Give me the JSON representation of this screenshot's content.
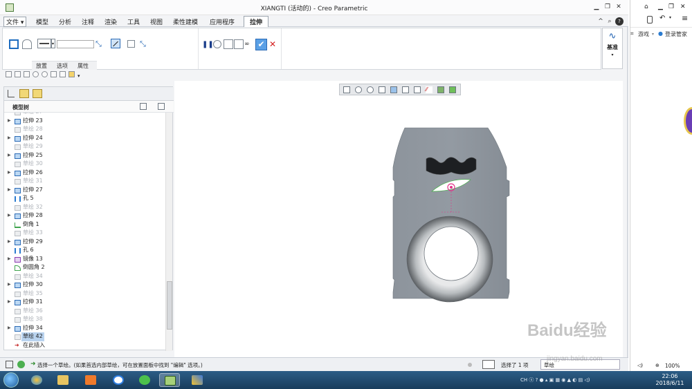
{
  "window": {
    "title": "XIANGTI (活动的) - Creo Parametric"
  },
  "menu": {
    "file": "文件",
    "tabs": [
      "模型",
      "分析",
      "注释",
      "渲染",
      "工具",
      "视图",
      "柔性建模",
      "应用程序"
    ],
    "active_tab": "拉伸"
  },
  "ribbon": {
    "subtabs": [
      "放置",
      "选项",
      "属性"
    ],
    "datum_label": "基准"
  },
  "tree": {
    "header": "模型树",
    "insert_here": "在此插入",
    "rows": [
      {
        "label": "草绘 27",
        "kind": "sketch",
        "dim": true,
        "arrow": false
      },
      {
        "label": "拉伸 23",
        "kind": "extrude",
        "dim": false,
        "arrow": true
      },
      {
        "label": "草绘 28",
        "kind": "sketch",
        "dim": true,
        "arrow": false
      },
      {
        "label": "拉伸 24",
        "kind": "extrude",
        "dim": false,
        "arrow": true
      },
      {
        "label": "草绘 29",
        "kind": "sketch",
        "dim": true,
        "arrow": false
      },
      {
        "label": "拉伸 25",
        "kind": "extrude",
        "dim": false,
        "arrow": true
      },
      {
        "label": "草绘 30",
        "kind": "sketch",
        "dim": true,
        "arrow": false
      },
      {
        "label": "拉伸 26",
        "kind": "extrude",
        "dim": false,
        "arrow": true
      },
      {
        "label": "草绘 31",
        "kind": "sketch",
        "dim": true,
        "arrow": false
      },
      {
        "label": "拉伸 27",
        "kind": "extrude",
        "dim": false,
        "arrow": true
      },
      {
        "label": "孔 5",
        "kind": "hole",
        "dim": false,
        "arrow": false
      },
      {
        "label": "草绘 32",
        "kind": "sketch",
        "dim": true,
        "arrow": false
      },
      {
        "label": "拉伸 28",
        "kind": "extrude",
        "dim": false,
        "arrow": true
      },
      {
        "label": "倒角 1",
        "kind": "chamfer",
        "dim": false,
        "arrow": false
      },
      {
        "label": "草绘 33",
        "kind": "sketch",
        "dim": true,
        "arrow": false
      },
      {
        "label": "拉伸 29",
        "kind": "extrude",
        "dim": false,
        "arrow": true
      },
      {
        "label": "孔 6",
        "kind": "hole",
        "dim": false,
        "arrow": false
      },
      {
        "label": "镜像 13",
        "kind": "mirror",
        "dim": false,
        "arrow": true
      },
      {
        "label": "倒圆角 2",
        "kind": "round",
        "dim": false,
        "arrow": false
      },
      {
        "label": "草绘 34",
        "kind": "sketch",
        "dim": true,
        "arrow": false
      },
      {
        "label": "拉伸 30",
        "kind": "extrude",
        "dim": false,
        "arrow": true
      },
      {
        "label": "草绘 35",
        "kind": "sketch",
        "dim": true,
        "arrow": false
      },
      {
        "label": "拉伸 31",
        "kind": "extrude",
        "dim": false,
        "arrow": true
      },
      {
        "label": "草绘 36",
        "kind": "sketch",
        "dim": true,
        "arrow": false
      },
      {
        "label": "草绘 38",
        "kind": "sketch",
        "dim": true,
        "arrow": false
      },
      {
        "label": "拉伸 34",
        "kind": "extrude",
        "dim": false,
        "arrow": true
      },
      {
        "label": "草绘 42",
        "kind": "sketch",
        "dim": false,
        "arrow": false,
        "selected": true
      }
    ]
  },
  "status": {
    "message": "选择一个草绘。(如果首选内部草绘，可在放置面板中找到 \"编辑\" 选项。)",
    "selected": "选择了 1 项",
    "filter": "草绘"
  },
  "browser": {
    "games": "游戏",
    "login": "登录管家",
    "zoom": "100%"
  },
  "taskbar": {
    "time": "22:06",
    "date": "2018/6/11",
    "lang": "CH"
  },
  "watermark": {
    "brand": "Baidu经验",
    "url": "jingyan.baidu.com"
  },
  "colors": {
    "part_gray": "#8c939b",
    "accent_blue": "#2a7bd0",
    "confirm_green": "#3fb24a",
    "cancel_red": "#d42020"
  }
}
